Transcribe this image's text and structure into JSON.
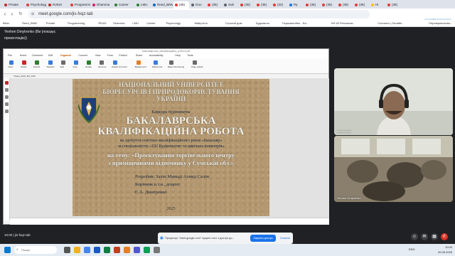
{
  "browser": {
    "tabs": [
      {
        "label": "Private",
        "color": "#c62828"
      },
      {
        "label": "Psychology",
        "color": "#e53935"
      },
      {
        "label": "RJ810",
        "color": "#c62828"
      },
      {
        "label": "Programming",
        "color": "#e53935"
      },
      {
        "label": "Dhamma",
        "color": "#d81b60"
      },
      {
        "label": "Career",
        "color": "#2e7d32"
      },
      {
        "label": "LMU",
        "color": "#2e7d32"
      },
      {
        "label": "Reed_BNM",
        "color": "#1565c0"
      },
      {
        "label": "(35)",
        "color": "#e53935"
      },
      {
        "label": "Goo",
        "color": "#5f6368"
      },
      {
        "label": "(35)",
        "color": "#e53935"
      },
      {
        "label": "Sub",
        "color": "#5f6368"
      },
      {
        "label": "(35)",
        "color": "#e53935"
      },
      {
        "label": "(35)",
        "color": "#e53935"
      },
      {
        "label": "(32)",
        "color": "#e53935"
      },
      {
        "label": "Pp",
        "color": "#1a73e8"
      },
      {
        "label": "(35)",
        "color": "#e53935"
      },
      {
        "label": "(35)",
        "color": "#e53935"
      },
      {
        "label": "(35)",
        "color": "#e53935"
      },
      {
        "label": "(35)",
        "color": "#e53935"
      },
      {
        "label": "Hi",
        "color": "#fbbc04"
      },
      {
        "label": "(35)",
        "color": "#e53935"
      }
    ],
    "url": "meet.google.com/jis-fxqz-tab",
    "update_label_1": "Доступне",
    "update_label_2": "оновлення",
    "bookmarks": [
      "Bitrix",
      "Reed_BNM",
      "Private",
      "Programming",
      "RE&D",
      "Dhamma",
      "LMU",
      "Career",
      "Psychology",
      "Mattpoll.ru",
      "Строгий дом",
      "Кудинисть",
      "Поршавтойно - Ба...",
      "НН 60 Ретеаліза...",
      "Coursera | Онлайн...",
      "Перевірничкова...",
      "Перевірнічкова..."
    ]
  },
  "meet": {
    "presenter_label": "Yevhen Dmytrenko (Ви (показує презентацію))",
    "participants": [
      {
        "name": "ocean Zitar"
      },
      {
        "name": "Yevhen Dmytrenko"
      }
    ],
    "meeting_info": "10:00  |  jis-fxqz-tab",
    "share_notice": "Процесорі \"meet.google.com\" пущені лист з доступ до...",
    "stop_label": "Закрити доступ",
    "hide_label": "Сховати"
  },
  "document": {
    "window_title": "Бакалаврська_кваліфікаційна_робота.pdf",
    "menu": [
      "File",
      "Home",
      "Comment",
      "Edit",
      "Organize",
      "Convert",
      "View",
      "Form",
      "Protect",
      "Share",
      "Accessibility",
      "Help",
      "Tools"
    ],
    "active_menu": "Organize",
    "ribbon_items": [
      "Insert",
      "Delete",
      "Extract",
      "Replace",
      "Split",
      "Crop",
      "Rotate",
      "Reverse",
      "Header & Footer",
      "Background",
      "Watermark",
      "Bates Numbering",
      "Page Labels"
    ],
    "file_tab": "Thesis_2024_BC_DOC",
    "page": {
      "line1": "НАЦІОНАЛЬНИЙ УНІВЕРСИТЕТ",
      "line2": "БІОРЕСУРСІВ І ПРИРОДОКОРИСТУВАННЯ",
      "line3": "УКРАЇНИ",
      "dept": "Кафедра будівництва",
      "title1": "БАКАЛАВРСЬКА",
      "title2": "КВАЛІФІКАЦІЙНА РОБОТА",
      "sub1": "на здобуття освітньо-кваліфікаційного рівня «бакалавр»",
      "sub2": "за спеціальністю «192 Будівництво та цивільна інженерія»",
      "topic1": "на тему: «Проєктування торгівельного центру",
      "topic2": "з приміщеннями відпочинку у Сумській обл.»",
      "author": "Розробив: Залін Мамаді Ахмед Салім",
      "supervisor": "Керівник к.т.н., доцент",
      "supervisor_name": "Є.А. Дмитренко",
      "year": "2025"
    }
  },
  "taskbar": {
    "search_placeholder": "Пошук",
    "time": "10:00",
    "date": "20.06.2025",
    "lang": "ENG"
  }
}
